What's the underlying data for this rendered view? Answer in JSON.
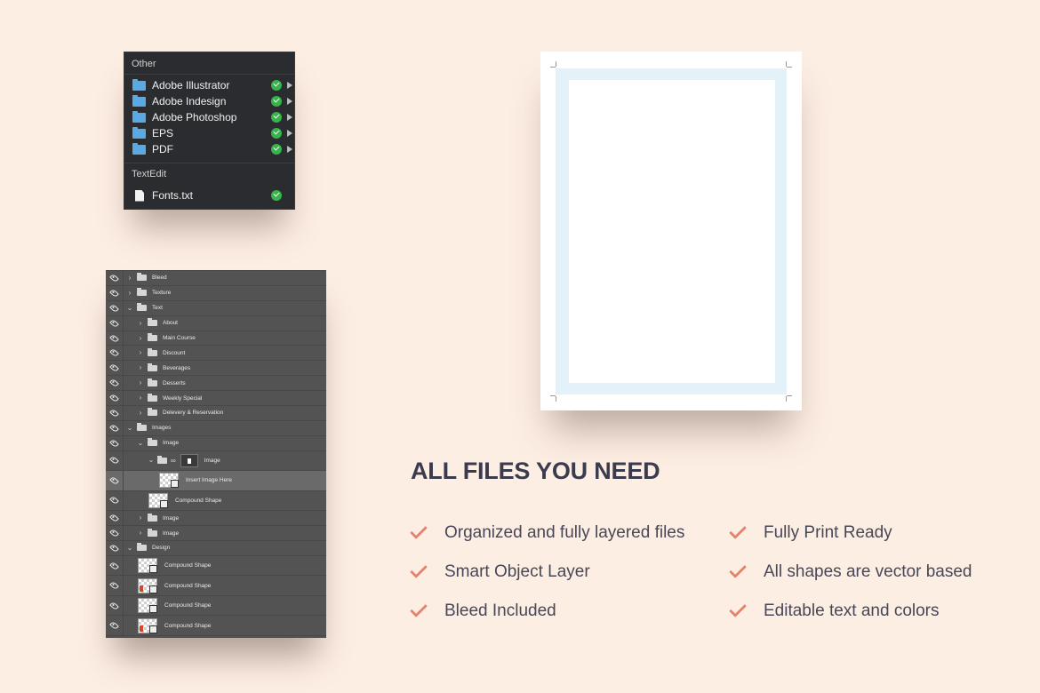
{
  "files_panel": {
    "group1_title": "Other",
    "group1_items": [
      "Adobe Illustrator",
      "Adobe Indesign",
      "Adobe Photoshop",
      "EPS",
      "PDF"
    ],
    "group2_title": "TextEdit",
    "group2_items": [
      "Fonts.txt"
    ]
  },
  "layers_panel": {
    "layers": [
      {
        "label": "Bleed"
      },
      {
        "label": "Texture"
      },
      {
        "label": "Text"
      },
      {
        "label": "About"
      },
      {
        "label": "Main Course"
      },
      {
        "label": "Discount"
      },
      {
        "label": "Beverages"
      },
      {
        "label": "Desserts"
      },
      {
        "label": "Weekly Special"
      },
      {
        "label": "Delevery & Reservation"
      },
      {
        "label": "Images"
      },
      {
        "label": "Image"
      },
      {
        "label": "Image"
      },
      {
        "label": "Insert Image Here"
      },
      {
        "label": "Compound Shape"
      },
      {
        "label": "Image"
      },
      {
        "label": "Image"
      },
      {
        "label": "Design"
      },
      {
        "label": "Compound Shape"
      },
      {
        "label": "Compound Shape"
      },
      {
        "label": "Compound Shape"
      },
      {
        "label": "Compound Shape"
      }
    ]
  },
  "features": {
    "title": "ALL FILES YOU NEED",
    "left": [
      "Organized and fully layered files",
      "Smart Object Layer",
      "Bleed Included"
    ],
    "right": [
      "Fully Print Ready",
      "All shapes are vector based",
      "Editable text and colors"
    ]
  },
  "colors": {
    "background": "#fdeee4",
    "accent": "#e5826c",
    "title": "#3b3b4e",
    "folder": "#5aa9e3",
    "check": "#35b44a",
    "bleed": "#e3f2f9"
  }
}
